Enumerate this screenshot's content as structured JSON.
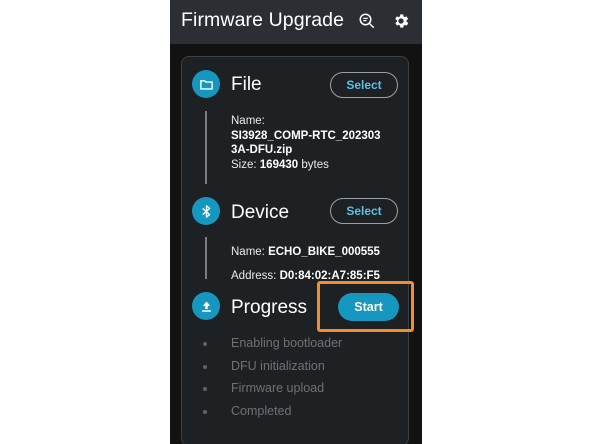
{
  "app": {
    "title": "Firmware Upgrade",
    "actions": [
      {
        "name": "search-icon"
      },
      {
        "name": "gear-icon"
      }
    ]
  },
  "file": {
    "heading": "File",
    "icon": "folder-icon",
    "select_label": "Select",
    "name_label": "Name:",
    "name_line1": "SI3928_COMP-RTC_202303",
    "name_line2": "3A-DFU.zip",
    "size_label": "Size:",
    "size_value": "169430",
    "size_unit": "bytes"
  },
  "device": {
    "heading": "Device",
    "icon": "bluetooth-icon",
    "select_label": "Select",
    "name_label": "Name:",
    "name_value": "ECHO_BIKE_000555",
    "address_label": "Address:",
    "address_value": "D0:84:02:A7:85:F5"
  },
  "progress": {
    "heading": "Progress",
    "icon": "upload-icon",
    "start_label": "Start",
    "stages": [
      "Enabling bootloader",
      "DFU initialization",
      "Firmware upload",
      "Completed"
    ]
  },
  "colors": {
    "accent": "#1597bf",
    "link": "#5cc0e6",
    "highlight": "#f28e2b"
  }
}
